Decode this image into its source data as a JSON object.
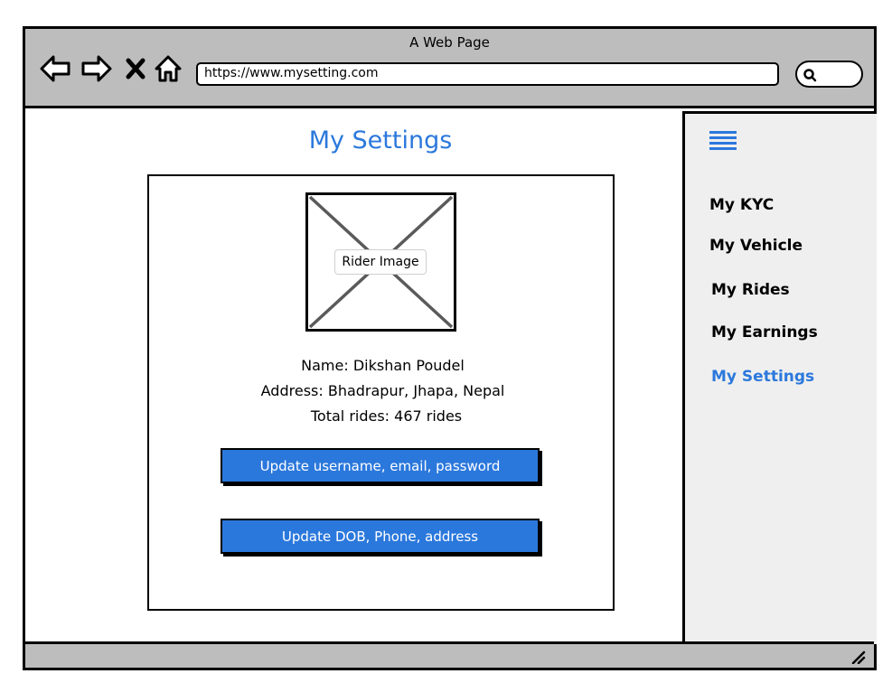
{
  "browser": {
    "window_title": "A Web Page",
    "url": "https://www.mysetting.com",
    "icons": {
      "back": "arrow-left-icon",
      "forward": "arrow-right-icon",
      "stop": "close-icon",
      "home": "home-icon",
      "search": "search-icon",
      "resize": "resize-grip-icon"
    }
  },
  "main": {
    "title": "My Settings",
    "profile": {
      "image_label": "Rider Image",
      "name_line": "Name: Dikshan Poudel",
      "address_line": "Address: Bhadrapur, Jhapa, Nepal",
      "rides_line": "Total rides: 467 rides"
    },
    "buttons": {
      "update_account": "Update username, email, password",
      "update_personal": "Update DOB, Phone, address"
    }
  },
  "sidebar": {
    "menu_icon": "hamburger-menu-icon",
    "items": [
      {
        "label": "My KYC"
      },
      {
        "label": "My Vehicle"
      },
      {
        "label": "My Rides"
      },
      {
        "label": "My Earnings"
      },
      {
        "label": "My Settings"
      }
    ],
    "active_index": 4
  },
  "colors": {
    "accent": "#2b78dc",
    "chrome": "#bdbdbd",
    "sidebar_bg": "#efefef"
  }
}
